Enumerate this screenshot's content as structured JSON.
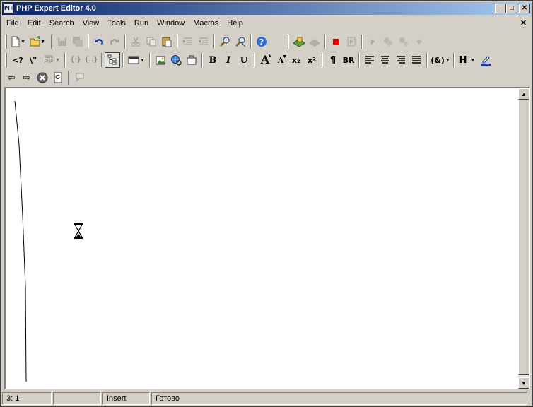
{
  "window": {
    "title": "PHP Expert Editor 4.0",
    "app_icon_text": "PHP",
    "minimize": "_",
    "maximize": "□",
    "close": "✕"
  },
  "menu": {
    "items": [
      "File",
      "Edit",
      "Search",
      "View",
      "Tools",
      "Run",
      "Window",
      "Macros",
      "Help"
    ],
    "mdi_close": "✕"
  },
  "toolbar2": {
    "php_open_tag": "<?",
    "html_php_label": "html PHP",
    "bold": "B",
    "italic": "I",
    "underline": "U",
    "font_bigger": "A",
    "font_smaller": "A",
    "subscript": "x₂",
    "superscript": "x²",
    "paragraph": "¶",
    "line_break": "BR",
    "entity": "(&)",
    "heading": "H"
  },
  "statusbar": {
    "position": "3: 1",
    "modified": "",
    "mode": "Insert",
    "status": "Готово"
  },
  "colors": {
    "title_start": "#0a246a",
    "title_end": "#a6caf0",
    "face": "#d4d0c8",
    "stop_red": "#e00000"
  }
}
